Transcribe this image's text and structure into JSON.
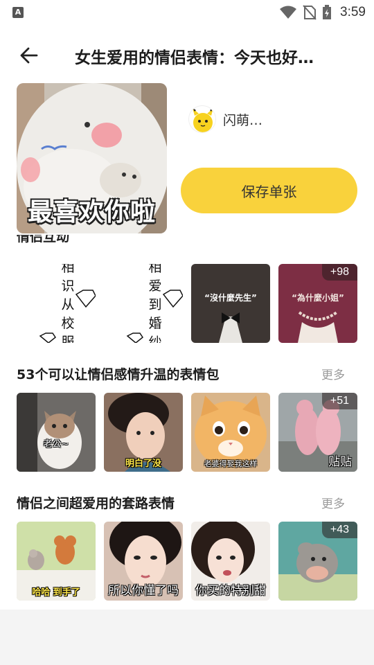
{
  "status_bar": {
    "time": "3:59",
    "notification_icon": "A"
  },
  "header": {
    "back_icon": "arrow-left-icon",
    "title": "女生爱用的情侣表情：今天也好…"
  },
  "hero": {
    "caption": "最喜欢你啦"
  },
  "author": {
    "name": "闪萌…"
  },
  "save_button": {
    "label": "保存单张"
  },
  "sections": [
    {
      "title": "情侣互动",
      "more": "",
      "thumbs": [
        {
          "text_lines": [
            "相",
            "识",
            "从",
            "校",
            "服"
          ]
        },
        {
          "text_lines": [
            "相",
            "爱",
            "到",
            "婚",
            "纱"
          ]
        },
        {
          "caption": "“沒什麼先生”"
        },
        {
          "caption": "“為什麼小姐”",
          "badge": "+98"
        }
      ]
    },
    {
      "title": "53个可以让情侣感情升温的表情包",
      "more": "更多",
      "thumbs": [
        {
          "caption": "老公~"
        },
        {
          "caption": "明白了没"
        },
        {
          "caption": "老婆得娶我这样"
        },
        {
          "caption": "贴贴",
          "badge": "+51"
        }
      ]
    },
    {
      "title": "情侣之间超爱用的套路表情",
      "more": "更多",
      "thumbs": [
        {
          "caption": "哈哈 到手了"
        },
        {
          "caption": "所以你懂了吗"
        },
        {
          "caption": "你买的特别甜"
        },
        {
          "caption": "",
          "badge": "+43"
        }
      ]
    }
  ],
  "colors": {
    "accent_yellow": "#f9d23c",
    "more_text": "#9a9a9a",
    "badge_bg": "rgba(40,30,30,0.55)"
  }
}
